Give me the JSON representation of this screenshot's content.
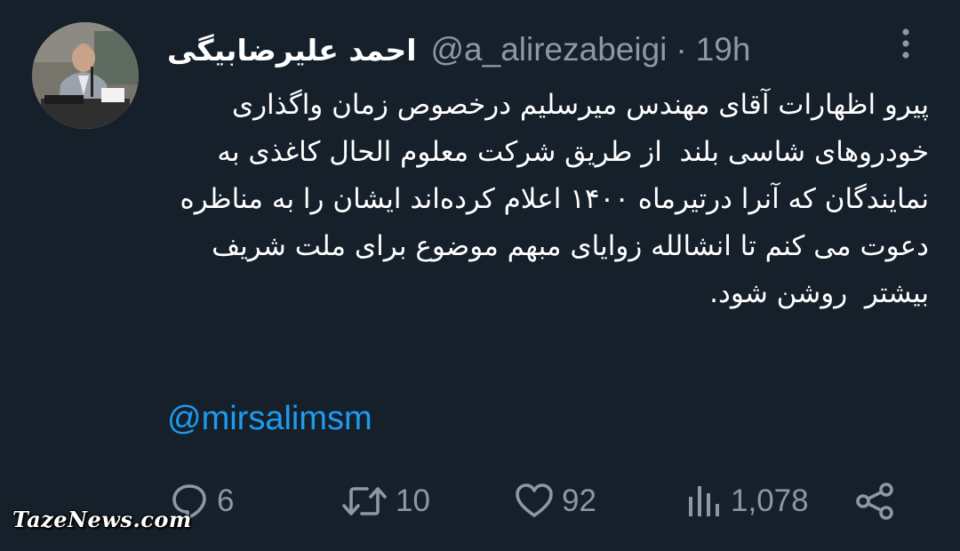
{
  "tweet": {
    "author": {
      "display_name": "احمد علیرضابیگی",
      "handle": "@a_alirezabeigi",
      "avatar_icon": "profile-photo-man-at-podium"
    },
    "separator": "·",
    "timestamp": "19h",
    "more_icon": "more-vertical-icon",
    "text": "پیرو اظهارات آقای مهندس میرسلیم درخصوص زمان واگذاری خودروهای شاسی بلند  از طریق شرکت معلوم الحال کاغذی به نمایندگان که آنرا درتیرماه ۱۴۰۰ اعلام کرده‌اند ایشان را به مناظره دعوت می کنم تا انشالله زوایای مبهم موضوع برای ملت شریف بیشتر  روشن شود.",
    "mention": "@mirsalimsm"
  },
  "actions": {
    "reply": {
      "icon": "reply-icon",
      "count": "6"
    },
    "retweet": {
      "icon": "retweet-icon",
      "count": "10"
    },
    "like": {
      "icon": "heart-icon",
      "count": "92"
    },
    "views": {
      "icon": "views-icon",
      "count": "1,078"
    },
    "share": {
      "icon": "share-icon"
    }
  },
  "watermark": "TazeNews.com",
  "colors": {
    "background": "#15202b",
    "text": "#ffffff",
    "secondary": "#8b98a5",
    "link": "#1d9bf0"
  }
}
